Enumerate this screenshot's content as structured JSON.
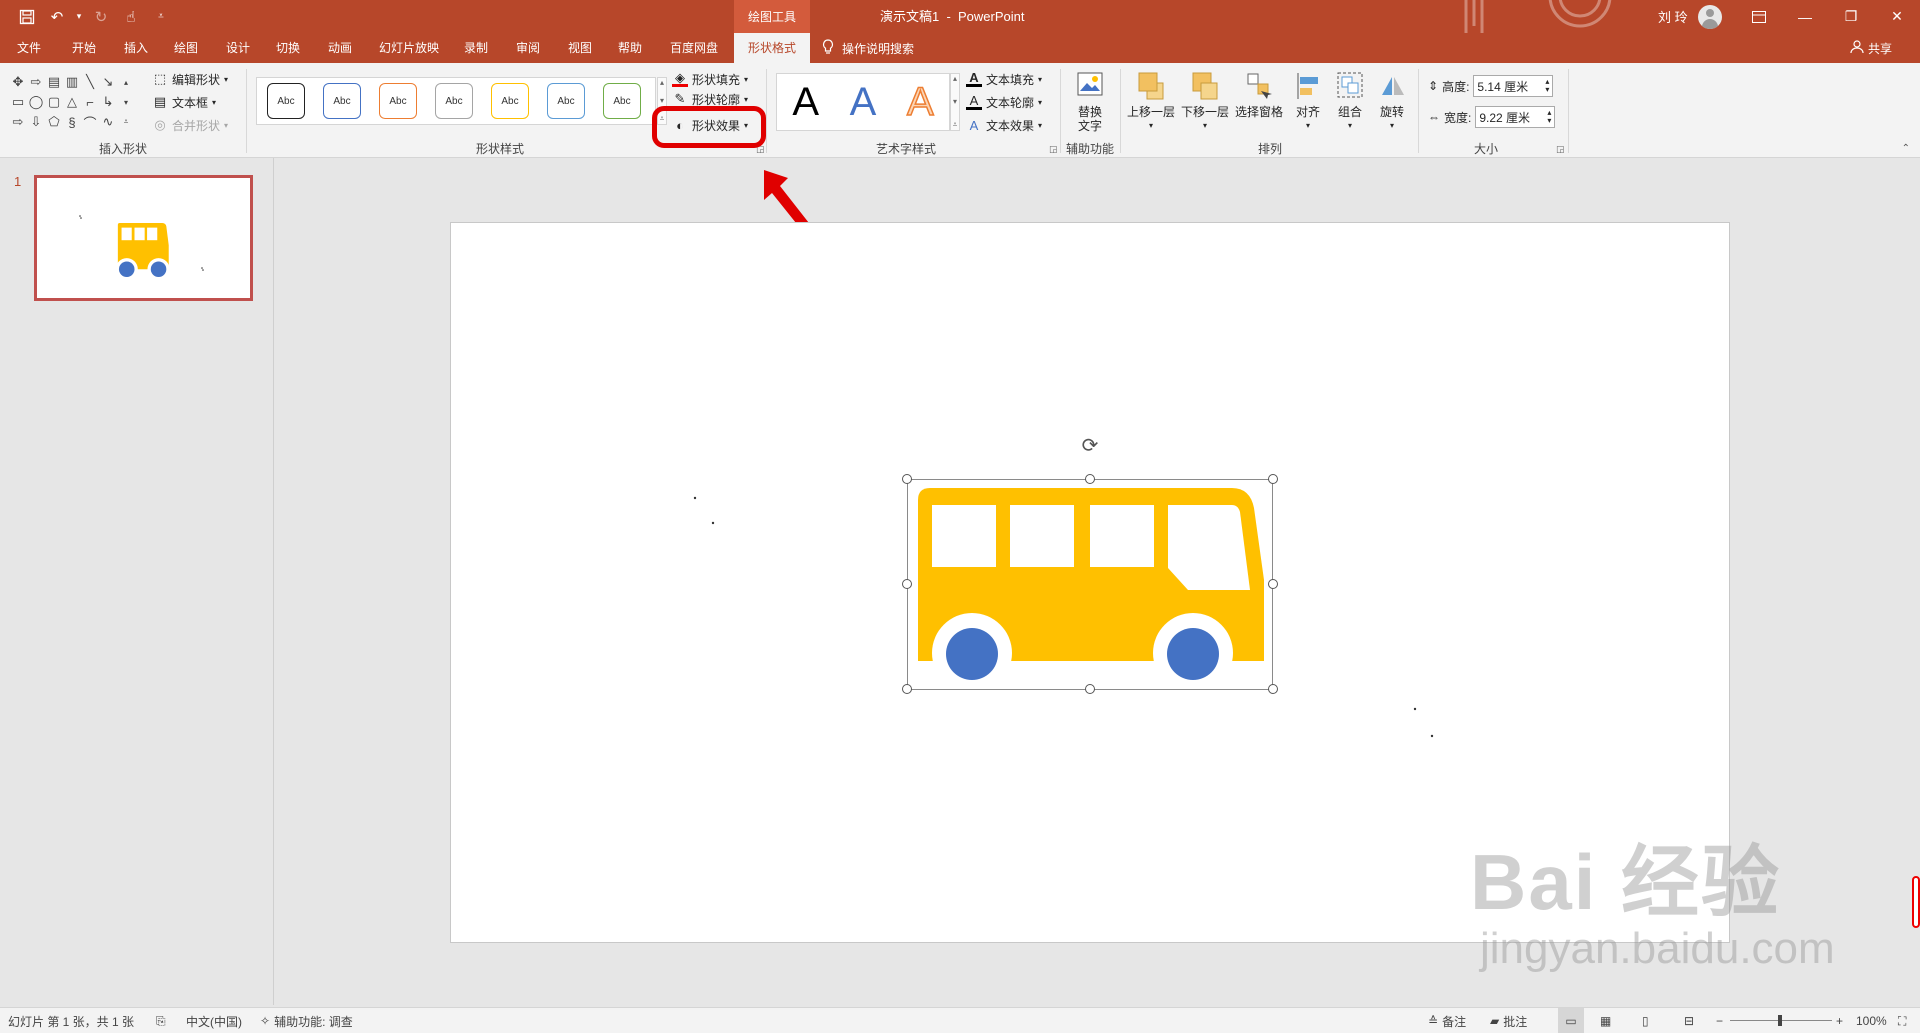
{
  "titlebar": {
    "context_tool": "绘图工具",
    "doc_title": "演示文稿1  -  PowerPoint",
    "user_name": "刘 玲",
    "colors": {
      "accent": "#b7472a",
      "context_tab": "#d35b3c"
    }
  },
  "tabs": [
    {
      "label": "文件"
    },
    {
      "label": "开始"
    },
    {
      "label": "插入"
    },
    {
      "label": "绘图"
    },
    {
      "label": "设计"
    },
    {
      "label": "切换"
    },
    {
      "label": "动画"
    },
    {
      "label": "幻灯片放映"
    },
    {
      "label": "录制"
    },
    {
      "label": "审阅"
    },
    {
      "label": "视图"
    },
    {
      "label": "帮助"
    },
    {
      "label": "百度网盘"
    },
    {
      "label": "形状格式"
    }
  ],
  "active_tab": "形状格式",
  "tell_me": "操作说明搜索",
  "share": "共享",
  "ribbon": {
    "insert_shapes": {
      "label": "插入形状",
      "edit_shape": "编辑形状",
      "text_box": "文本框",
      "merge_shapes": "合并形状"
    },
    "shape_styles": {
      "label": "形状样式",
      "gallery": [
        {
          "text": "Abc",
          "color": "#222222"
        },
        {
          "text": "Abc",
          "color": "#4472c4"
        },
        {
          "text": "Abc",
          "color": "#ed7d31"
        },
        {
          "text": "Abc",
          "color": "#a5a5a5"
        },
        {
          "text": "Abc",
          "color": "#ffc000"
        },
        {
          "text": "Abc",
          "color": "#5b9bd5"
        },
        {
          "text": "Abc",
          "color": "#70ad47"
        }
      ],
      "fill": "形状填充",
      "outline": "形状轮廓",
      "effects": "形状效果"
    },
    "wordart": {
      "label": "艺术字样式",
      "samples": [
        "A",
        "A",
        "A"
      ],
      "text_fill": "文本填充",
      "text_outline": "文本轮廓",
      "text_effects": "文本效果"
    },
    "accessibility": {
      "label": "辅助功能",
      "alt_text": "替换文字"
    },
    "arrange": {
      "label": "排列",
      "bring_forward": "上移一层",
      "send_backward": "下移一层",
      "selection_pane": "选择窗格",
      "align": "对齐",
      "group": "组合",
      "rotate": "旋转"
    },
    "size": {
      "label": "大小",
      "height_label": "高度:",
      "height_value": "5.14 厘米",
      "width_label": "宽度:",
      "width_value": "9.22 厘米"
    }
  },
  "slides_pane": {
    "slide_number": "1"
  },
  "slide": {
    "bus": {
      "body_color": "#ffc000",
      "wheel_color": "#4472c4"
    }
  },
  "watermark": {
    "brand": "Bai   经验",
    "url": "jingyan.baidu.com"
  },
  "statusbar": {
    "slide_info": "幻灯片 第 1 张，共 1 张",
    "language": "中文(中国)",
    "accessibility": "辅助功能: 调查",
    "notes": "备注",
    "comments": "批注",
    "zoom": "100%"
  },
  "icons": [
    "save-icon",
    "undo-icon",
    "redo-icon",
    "touch-mode-icon",
    "customize-qat-icon",
    "lightbulb-icon",
    "person-icon",
    "rotate-handle-icon",
    "minimize-icon",
    "restore-icon",
    "close-icon"
  ]
}
